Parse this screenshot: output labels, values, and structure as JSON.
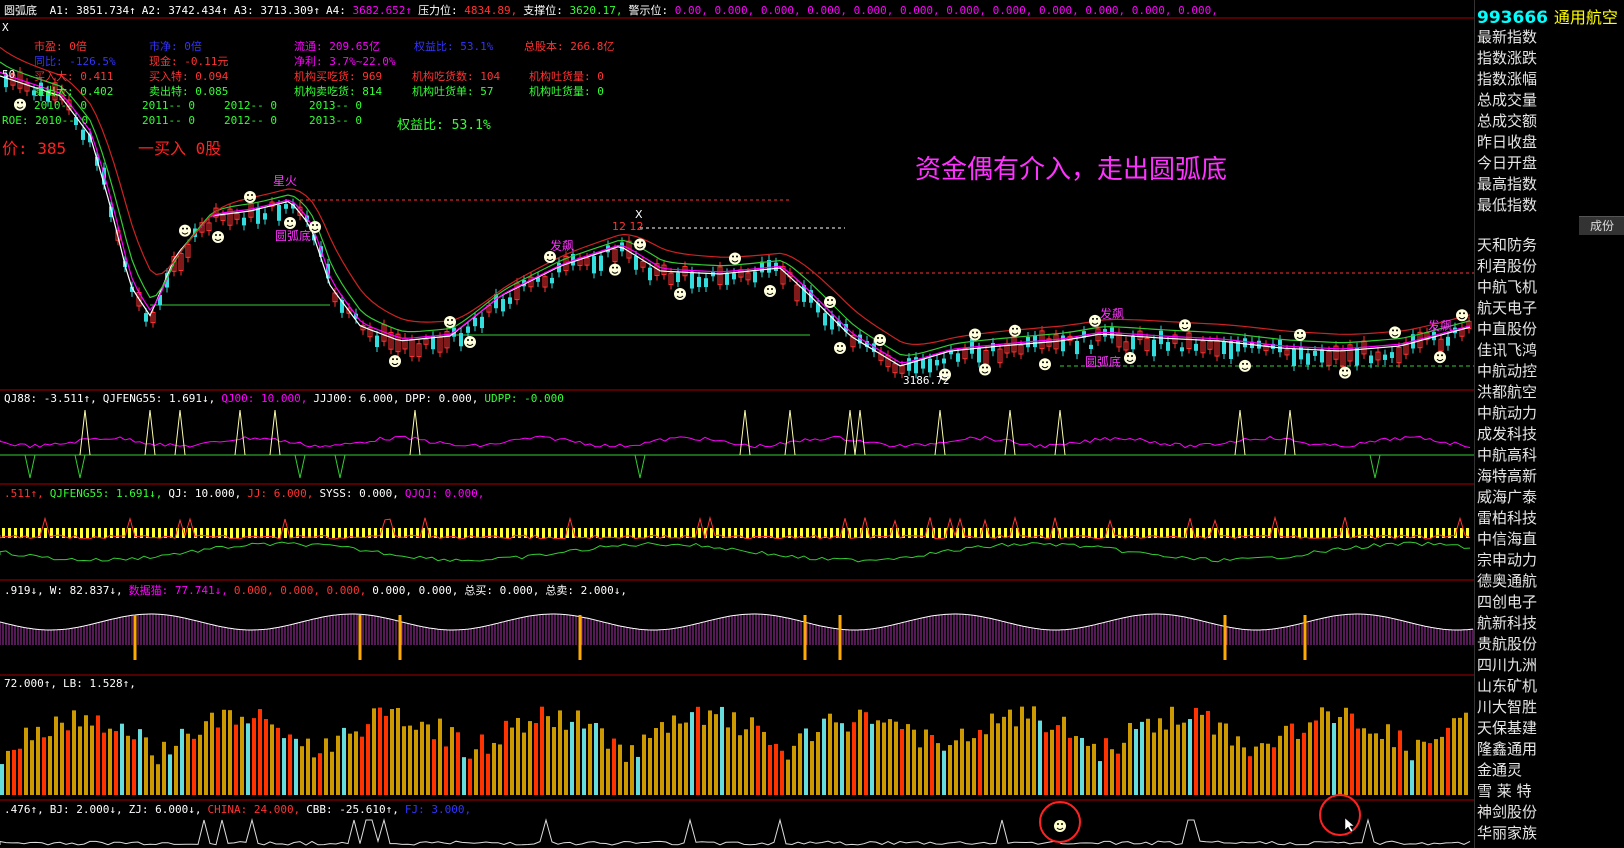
{
  "top_bar": {
    "title": "圆弧底",
    "items": [
      {
        "label": "A1:",
        "value": "3851.734↑",
        "color": "#ffffff"
      },
      {
        "label": "A2:",
        "value": "3742.434↑",
        "color": "#ffffff"
      },
      {
        "label": "A3:",
        "value": "3713.309↑",
        "color": "#ffffff"
      },
      {
        "label": "A4:",
        "value": "3682.652↑",
        "color": "#ff00ff"
      },
      {
        "label": "压力位:",
        "value": "4834.89,",
        "color": "#ff3333"
      },
      {
        "label": "支撑位:",
        "value": "3620.17,",
        "color": "#33ff33"
      },
      {
        "label": "警示位:",
        "value": "0.00, 0.000, 0.000, 0.000, 0.000, 0.000, 0.000, 0.000, 0.000, 0.000, 0.000, 0.000,",
        "color": "#ff00ff"
      }
    ]
  },
  "info_box": {
    "row1": [
      "市盈: 0倍",
      "市净: 0倍",
      "流通: 209.65亿",
      "权益比: 53.1%",
      "总股本: 266.8亿"
    ],
    "row2": [
      "同比: -126.5%",
      "现金: -0.11元",
      "净利: 3.7%~22.0%"
    ],
    "row3": [
      "买入大: 0.411",
      "买入特: 0.094",
      "机构买吃货: 969",
      "机构吃货数: 104",
      "机构吐货量: 0"
    ],
    "row4": [
      "卖出大: 0.402",
      "卖出特: 0.085",
      "机构卖吃货: 814",
      "机构吐货单: 57",
      "机构吐货量: 0"
    ],
    "row5": [
      "2010-- 0",
      "2011-- 0",
      "2012-- 0",
      "2013-- 0"
    ],
    "row6": [
      "ROE: 2010-- 0",
      "2011-- 0",
      "2012-- 0",
      "2013-- 0",
      "权益比: 53.1%"
    ],
    "left_50": "50",
    "x_marker": "X",
    "price_line": "价: 385",
    "buy_line": "一买入 0股"
  },
  "annotation": "资金偶有介入，走出圆弧底",
  "chart_labels": {
    "low_price": "3186.72",
    "star_fire": "星火",
    "arc_bottom_1": "圆弧底",
    "arc_bottom_2": "圆弧底",
    "fa_biao_1": "发飙",
    "fa_biao_2": "发飙",
    "fa_biao_3": "发飙",
    "num_12": "12 12",
    "x_top": "X"
  },
  "indicators": {
    "ind1": [
      {
        "text": "QJ88: -3.511↑,",
        "color": "#ffffff"
      },
      {
        "text": "QJFENG55: 1.691↓,",
        "color": "#ffffff"
      },
      {
        "text": "QJ00: 10.000,",
        "color": "#ff00ff"
      },
      {
        "text": "JJJ00: 6.000,",
        "color": "#ffffff"
      },
      {
        "text": "DPP: 0.000,",
        "color": "#ffffff"
      },
      {
        "text": "UDPP: -0.000",
        "color": "#33ff33"
      }
    ],
    "ind2": [
      {
        "text": ".511↑,",
        "color": "#ff3333"
      },
      {
        "text": "QJFENG55: 1.691↓,",
        "color": "#33ff33"
      },
      {
        "text": "QJ: 10.000,",
        "color": "#ffffff"
      },
      {
        "text": "JJ: 6.000,",
        "color": "#ff3333"
      },
      {
        "text": "SYSS: 0.000,",
        "color": "#ffffff"
      },
      {
        "text": "QJQJ: 0.000,",
        "color": "#ff00ff"
      }
    ],
    "ind3": [
      {
        "text": ".919↓,",
        "color": "#ffffff"
      },
      {
        "text": "W: 82.837↓,",
        "color": "#ffffff"
      },
      {
        "text": "数据猫: 77.741↓,",
        "color": "#ff00ff"
      },
      {
        "text": "0.000, 0.000, 0.000,",
        "color": "#ff3333"
      },
      {
        "text": "0.000, 0.000,",
        "color": "#ffffff"
      },
      {
        "text": "总买: 0.000,",
        "color": "#ffffff"
      },
      {
        "text": "总卖: 2.000↓,",
        "color": "#ffffff"
      }
    ],
    "ind4": [
      {
        "text": "72.000↑,",
        "color": "#ffffff"
      },
      {
        "text": "LB: 1.528↑,",
        "color": "#ffffff"
      }
    ],
    "ind5": [
      {
        "text": ".476↑,",
        "color": "#ffffff"
      },
      {
        "text": "BJ: 2.000↓,",
        "color": "#ffffff"
      },
      {
        "text": "ZJ: 6.000↓,",
        "color": "#ffffff"
      },
      {
        "text": "CHINA: 24.000,",
        "color": "#ff3333"
      },
      {
        "text": "CBB: -25.610↑,",
        "color": "#ffffff"
      },
      {
        "text": "FJ: 3.000,",
        "color": "#3333ff"
      }
    ]
  },
  "sidebar": {
    "code": "993666",
    "name": "通用航空",
    "menu": [
      "最新指数",
      "指数涨跌",
      "指数涨幅",
      "总成交量",
      "总成交额",
      "昨日收盘",
      "今日开盘",
      "最高指数",
      "最低指数"
    ],
    "tab": "成份",
    "stocks": [
      "天和防务",
      "利君股份",
      "中航飞机",
      "航天电子",
      "中直股份",
      "佳讯飞鸿",
      "中航动控",
      "洪都航空",
      "中航动力",
      "成发科技",
      "中航高科",
      "海特高新",
      "威海广泰",
      "雷柏科技",
      "中信海直",
      "宗申动力",
      "德奥通航",
      "四创电子",
      "航新科技",
      "贵航股份",
      "四川九洲",
      "山东矿机",
      "川大智胜",
      "天保基建",
      "隆鑫通用",
      "金通灵",
      "雪 莱 特",
      "神剑股份",
      "华丽家族"
    ]
  },
  "colors": {
    "up": "#ff3333",
    "down": "#33dddd",
    "ma_white": "#ffffff",
    "ma_magenta": "#ff00ff",
    "ma_green": "#33cc33",
    "ma_red": "#cc2222",
    "annotation": "#ff33ff",
    "separator": "#aa0000"
  }
}
